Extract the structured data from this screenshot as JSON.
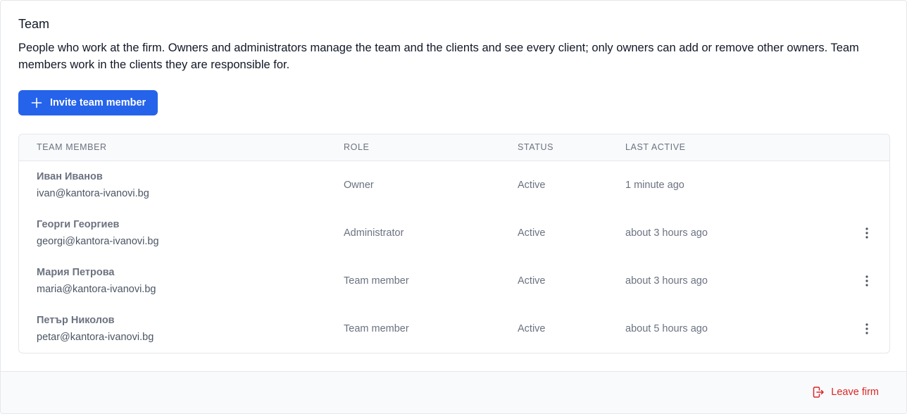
{
  "section": {
    "title": "Team",
    "description": "People who work at the firm. Owners and administrators manage the team and the clients and see every client; only owners can add or remove other owners. Team members work in the clients they are responsible for."
  },
  "actions": {
    "invite_label": "Invite team member",
    "invite_icon": "plus-icon"
  },
  "table": {
    "headers": {
      "member": "TEAM MEMBER",
      "role": "ROLE",
      "status": "STATUS",
      "last_active": "LAST ACTIVE"
    },
    "rows": [
      {
        "name": "Иван Иванов",
        "email": "ivan@kantora-ivanovi.bg",
        "role": "Owner",
        "status": "Active",
        "last_active": "1 minute ago",
        "has_menu": false
      },
      {
        "name": "Георги Георгиев",
        "email": "georgi@kantora-ivanovi.bg",
        "role": "Administrator",
        "status": "Active",
        "last_active": "about 3 hours ago",
        "has_menu": true
      },
      {
        "name": "Мария Петрова",
        "email": "maria@kantora-ivanovi.bg",
        "role": "Team member",
        "status": "Active",
        "last_active": "about 3 hours ago",
        "has_menu": true
      },
      {
        "name": "Петър Николов",
        "email": "petar@kantora-ivanovi.bg",
        "role": "Team member",
        "status": "Active",
        "last_active": "about 5 hours ago",
        "has_menu": true
      }
    ]
  },
  "footer": {
    "leave_label": "Leave firm",
    "leave_icon": "logout-icon"
  },
  "colors": {
    "primary": "#2563eb",
    "danger": "#dc2626",
    "muted_text": "#6b7280",
    "border": "#e5e7eb",
    "header_bg": "#f9fafb"
  }
}
